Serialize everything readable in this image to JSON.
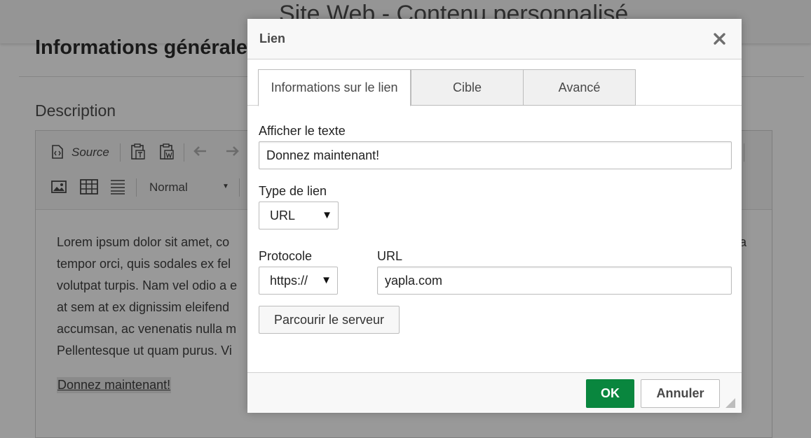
{
  "background_page": {
    "header_title": "Site Web - Contenu personnalisé",
    "section_title": "Informations générales",
    "description_label": "Description",
    "editor": {
      "toolbar": {
        "source_label": "Source",
        "format_value": "Normal"
      },
      "paragraph_lines": [
        "Lorem ipsum dolor sit amet, co",
        "tempor orci, quis sodales ex fel",
        "volutpat turpis. Nam vel odio a e",
        "at sem at ex dignissim eleifend",
        "accumsan, ac venenatis nulla m",
        "Pellentesque ut quam purus. Vi"
      ],
      "paragraph_line_end": "a",
      "link_text": "Donnez maintenant!"
    }
  },
  "dialog": {
    "title": "Lien",
    "tabs": [
      {
        "label": "Informations sur le lien",
        "active": true
      },
      {
        "label": "Cible",
        "active": false
      },
      {
        "label": "Avancé",
        "active": false
      }
    ],
    "display_text": {
      "label": "Afficher le texte",
      "value": "Donnez maintenant!"
    },
    "link_type": {
      "label": "Type de lien",
      "value": "URL"
    },
    "protocol": {
      "label": "Protocole",
      "value": "https://"
    },
    "url": {
      "label": "URL",
      "value": "yapla.com"
    },
    "browse_server_label": "Parcourir le serveur",
    "ok_label": "OK",
    "cancel_label": "Annuler"
  },
  "colors": {
    "ok_button": "#09863e",
    "overlay": "#9a9a9a"
  },
  "icons": [
    "close-icon",
    "source-icon",
    "paste-text-icon",
    "paste-word-icon",
    "undo-icon",
    "redo-icon",
    "image-icon",
    "table-icon",
    "horizontal-rule-icon",
    "dropdown-arrow-icon",
    "resize-grip-icon"
  ]
}
